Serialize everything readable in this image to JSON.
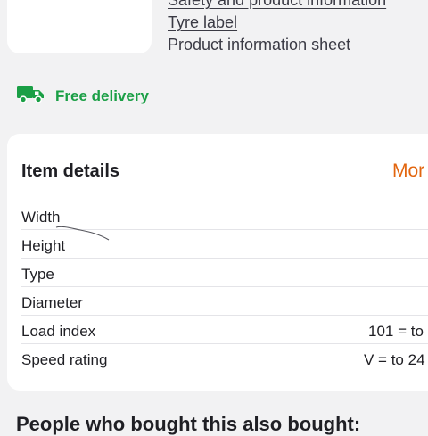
{
  "product": {
    "image_alt": "tyre-image"
  },
  "links": [
    {
      "label": "Safety and product information"
    },
    {
      "label": "Tyre label"
    },
    {
      "label": "Product information sheet"
    }
  ],
  "delivery": {
    "label": "Free delivery",
    "icon": "truck-icon",
    "color": "#1a9f45"
  },
  "details": {
    "title": "Item details",
    "more_label": "Mor",
    "rows": [
      {
        "label": "Width",
        "value": ""
      },
      {
        "label": "Height",
        "value": ""
      },
      {
        "label": "Type",
        "value": ""
      },
      {
        "label": "Diameter",
        "value": ""
      },
      {
        "label": "Load index",
        "value": "101 = to"
      },
      {
        "label": "Speed rating",
        "value": "V = to 24"
      }
    ]
  },
  "also_bought": {
    "title": "People who bought this also bought:"
  },
  "colors": {
    "accent": "#e2650e",
    "background": "#f2f2f3",
    "card": "#ffffff"
  }
}
